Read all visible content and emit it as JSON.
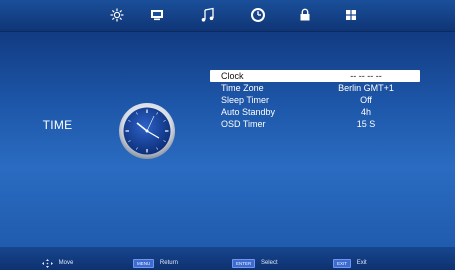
{
  "top_nav": {
    "icons": [
      "picture-icon",
      "sound-icon",
      "music-icon",
      "time-icon",
      "lock-icon",
      "setup-icon"
    ]
  },
  "section_title": "TIME",
  "menu": {
    "items": [
      {
        "label": "Clock",
        "value": "-- -- -- --"
      },
      {
        "label": "Time Zone",
        "value": "Berlin GMT+1"
      },
      {
        "label": "Sleep Timer",
        "value": "Off"
      },
      {
        "label": "Auto Standby",
        "value": "4h"
      },
      {
        "label": "OSD Timer",
        "value": "15 S"
      }
    ]
  },
  "footer": {
    "move_label": "Move",
    "return_key": "MENU",
    "return_label": "Return",
    "select_key": "ENTER",
    "select_label": "Select",
    "exit_key": "EXIT",
    "exit_label": "Exit"
  },
  "colors": {
    "background": "#1d56a8",
    "selection_bg": "#ffffff",
    "text": "#ffffff"
  }
}
